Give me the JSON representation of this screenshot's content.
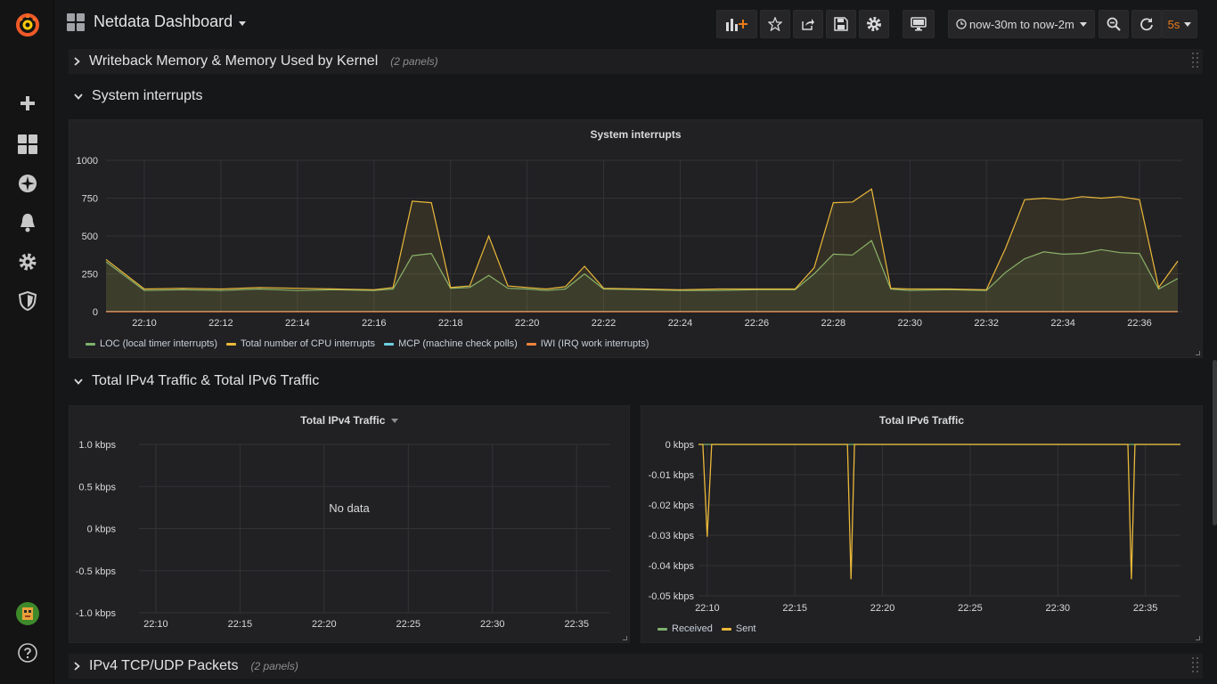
{
  "app": {
    "title": "Netdata Dashboard",
    "accent_color": "#eb7b18"
  },
  "sidemenu": {
    "items": [
      {
        "icon": "grafana-logo-icon"
      },
      {
        "icon": "plus-icon"
      },
      {
        "icon": "dashboards-icon"
      },
      {
        "icon": "explore-compass-icon"
      },
      {
        "icon": "alerting-bell-icon"
      },
      {
        "icon": "configuration-gear-icon"
      },
      {
        "icon": "server-admin-shield-icon"
      },
      {
        "icon": "user-avatar-icon"
      },
      {
        "icon": "help-icon"
      }
    ]
  },
  "toolbar": {
    "add_panel_icon": "add-panel-icon",
    "star_icon": "star-icon",
    "share_icon": "share-icon",
    "save_icon": "save-icon",
    "settings_icon": "gear-icon",
    "tv_mode_icon": "monitor-icon",
    "time_range": "now-30m to now-2m",
    "zoom_icon": "zoom-out-icon",
    "refresh_icon": "refresh-icon",
    "refresh_interval": "5s"
  },
  "rows": {
    "writeback": {
      "title": "Writeback Memory & Memory Used by Kernel",
      "count": "(2 panels)"
    },
    "interrupts": {
      "title": "System interrupts"
    },
    "traffic": {
      "title": "Total IPv4 Traffic & Total IPv6 Traffic"
    },
    "packets": {
      "title": "IPv4 TCP/UDP Packets",
      "count": "(2 panels)"
    }
  },
  "panels": {
    "interrupts": {
      "title": "System interrupts",
      "legend": [
        {
          "label": "LOC (local timer interrupts)",
          "color": "#7eb26d"
        },
        {
          "label": "Total number of CPU interrupts",
          "color": "#eab839"
        },
        {
          "label": "MCP (machine check polls)",
          "color": "#6ed0e0"
        },
        {
          "label": "IWI (IRQ work interrupts)",
          "color": "#ef843c"
        }
      ]
    },
    "ipv4": {
      "title": "Total IPv4 Traffic",
      "no_data": "No data"
    },
    "ipv6": {
      "title": "Total IPv6 Traffic",
      "legend": [
        {
          "label": "Received",
          "color": "#7eb26d"
        },
        {
          "label": "Sent",
          "color": "#eab839"
        }
      ]
    }
  },
  "chart_data": [
    {
      "type": "area",
      "title": "System interrupts",
      "x": [
        "22:09",
        "22:10",
        "22:11",
        "22:12",
        "22:13",
        "22:14",
        "22:15",
        "22:16",
        "22:16.5",
        "22:17",
        "22:17.5",
        "22:18",
        "22:18.5",
        "22:19",
        "22:19.5",
        "22:20",
        "22:20.5",
        "22:21",
        "22:21.5",
        "22:22",
        "22:23",
        "22:24",
        "22:25",
        "22:26",
        "22:27",
        "22:27.5",
        "22:28",
        "22:28.5",
        "22:29",
        "22:29.5",
        "22:30",
        "22:31",
        "22:32",
        "22:32.5",
        "22:33",
        "22:33.5",
        "22:34",
        "22:34.5",
        "22:35",
        "22:35.5",
        "22:36",
        "22:36.5",
        "22:37"
      ],
      "x_ticks": [
        "22:10",
        "22:12",
        "22:14",
        "22:16",
        "22:18",
        "22:20",
        "22:22",
        "22:24",
        "22:26",
        "22:28",
        "22:30",
        "22:32",
        "22:34",
        "22:36"
      ],
      "ylim": [
        0,
        1000
      ],
      "y_ticks": [
        0,
        250,
        500,
        750,
        1000
      ],
      "series": [
        {
          "name": "LOC (local timer interrupts)",
          "color": "#7eb26d",
          "values": [
            330,
            140,
            145,
            140,
            150,
            140,
            145,
            140,
            150,
            370,
            385,
            155,
            160,
            240,
            155,
            150,
            140,
            150,
            250,
            150,
            145,
            140,
            140,
            145,
            145,
            250,
            380,
            375,
            470,
            150,
            140,
            145,
            140,
            260,
            350,
            395,
            380,
            385,
            410,
            390,
            385,
            150,
            220
          ]
        },
        {
          "name": "Total number of CPU interrupts",
          "color": "#eab839",
          "values": [
            345,
            150,
            155,
            150,
            160,
            155,
            150,
            145,
            160,
            730,
            720,
            160,
            170,
            500,
            170,
            160,
            150,
            165,
            300,
            155,
            150,
            145,
            150,
            150,
            150,
            290,
            720,
            725,
            810,
            155,
            150,
            150,
            145,
            420,
            740,
            750,
            740,
            760,
            750,
            760,
            740,
            160,
            335
          ]
        },
        {
          "name": "MCP (machine check polls)",
          "color": "#6ed0e0",
          "values": [
            2,
            2,
            2,
            2,
            2,
            2,
            2,
            2,
            2,
            2,
            2,
            2,
            2,
            2,
            2,
            2,
            2,
            2,
            2,
            2,
            2,
            2,
            2,
            2,
            2,
            2,
            2,
            2,
            2,
            2,
            2,
            2,
            2,
            2,
            2,
            2,
            2,
            2,
            2,
            2,
            2,
            2,
            2
          ]
        },
        {
          "name": "IWI (IRQ work interrupts)",
          "color": "#ef843c",
          "values": [
            0,
            0,
            0,
            0,
            0,
            0,
            0,
            0,
            0,
            0,
            0,
            0,
            0,
            0,
            0,
            0,
            0,
            0,
            0,
            0,
            0,
            0,
            0,
            0,
            0,
            0,
            0,
            0,
            0,
            0,
            0,
            0,
            0,
            0,
            0,
            0,
            0,
            0,
            0,
            0,
            0,
            0,
            0
          ]
        }
      ]
    },
    {
      "type": "line",
      "title": "Total IPv4 Traffic",
      "x_ticks": [
        "22:10",
        "22:15",
        "22:20",
        "22:25",
        "22:30",
        "22:35"
      ],
      "y_ticks": [
        "1.0 kbps",
        "0.5 kbps",
        "0 kbps",
        "-0.5 kbps",
        "-1.0 kbps"
      ],
      "series": []
    },
    {
      "type": "line",
      "title": "Total IPv6 Traffic",
      "x_ticks": [
        "22:10",
        "22:15",
        "22:20",
        "22:25",
        "22:30",
        "22:35"
      ],
      "y_ticks": [
        "0 kbps",
        "-0.01 kbps",
        "-0.02 kbps",
        "-0.03 kbps",
        "-0.04 kbps",
        "-0.05 kbps"
      ],
      "ylim": [
        -0.05,
        0
      ],
      "series": [
        {
          "name": "Received",
          "color": "#7eb26d",
          "x": [
            "22:09.5",
            "22:37"
          ],
          "values": [
            0,
            0
          ]
        },
        {
          "name": "Sent",
          "color": "#eab839",
          "x": [
            "22:09.5",
            "22:09.75",
            "22:10",
            "22:10.25",
            "22:18",
            "22:18.2",
            "22:18.4",
            "22:34",
            "22:34.2",
            "22:34.4",
            "22:37"
          ],
          "values": [
            0,
            0,
            -0.0305,
            0,
            0,
            -0.0445,
            0,
            0,
            -0.0445,
            0,
            0
          ]
        }
      ]
    }
  ]
}
